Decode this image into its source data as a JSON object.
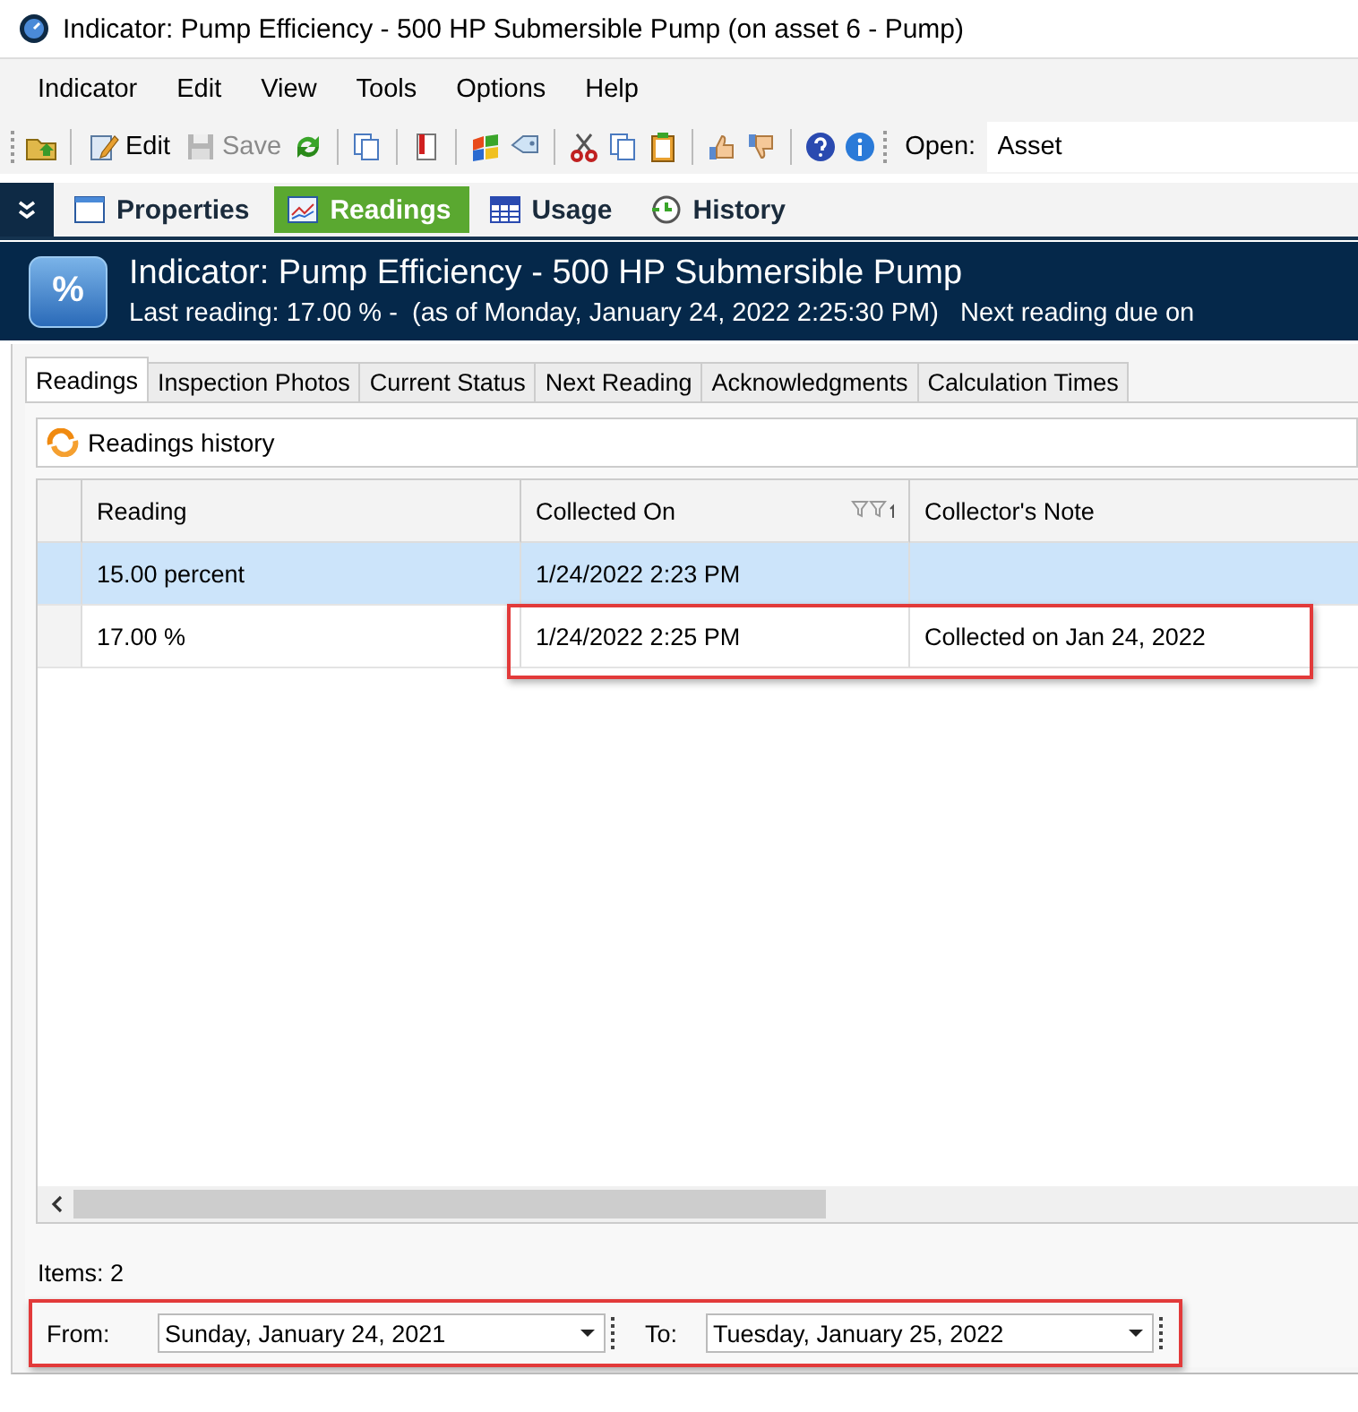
{
  "window": {
    "title": "Indicator: Pump Efficiency - 500 HP Submersible Pump (on asset 6 - Pump)"
  },
  "menu": [
    "Indicator",
    "Edit",
    "View",
    "Tools",
    "Options",
    "Help"
  ],
  "toolbar": [
    {
      "kind": "icon"
    },
    {
      "kind": "separator"
    },
    {
      "kind": "button",
      "label": "Edit",
      "disabled": false
    },
    {
      "kind": "button",
      "label": "Save",
      "disabled": true
    },
    {
      "kind": "icon"
    },
    {
      "kind": "separator"
    },
    {
      "kind": "icon"
    },
    {
      "kind": "separator"
    },
    {
      "kind": "icon"
    },
    {
      "kind": "separator"
    },
    {
      "kind": "icon"
    },
    {
      "kind": "icon"
    },
    {
      "kind": "separator"
    },
    {
      "kind": "icon"
    },
    {
      "kind": "icon"
    },
    {
      "kind": "icon"
    },
    {
      "kind": "separator"
    },
    {
      "kind": "icon"
    },
    {
      "kind": "icon"
    },
    {
      "kind": "separator"
    },
    {
      "kind": "icon"
    },
    {
      "kind": "icon"
    }
  ],
  "open_field": {
    "label": "Open:",
    "value": "Asset"
  },
  "nav_tabs": [
    {
      "label": "Properties",
      "selected": false
    },
    {
      "label": "Readings",
      "selected": true
    },
    {
      "label": "Usage",
      "selected": false
    },
    {
      "label": "History",
      "selected": false
    }
  ],
  "header": {
    "icon_text": "%",
    "title": "Indicator: Pump Efficiency - 500 HP Submersible Pump",
    "subtitle": "Last reading: 17.00 % -  (as of Monday, January 24, 2022 2:25:30 PM)   Next reading due on"
  },
  "tabs": [
    {
      "label": "Readings",
      "selected": true
    },
    {
      "label": "Inspection Photos",
      "selected": false
    },
    {
      "label": "Current Status",
      "selected": false
    },
    {
      "label": "Next Reading",
      "selected": false
    },
    {
      "label": "Acknowledgments",
      "selected": false
    },
    {
      "label": "Calculation Times",
      "selected": false
    }
  ],
  "group_title": "Readings history",
  "grid": {
    "columns": [
      "Reading",
      "Collected On",
      "Collector's Note"
    ],
    "rows": [
      {
        "cells": [
          "15.00 percent",
          "1/24/2022 2:23 PM",
          ""
        ],
        "selected": true,
        "highlighted": false
      },
      {
        "cells": [
          "17.00 %",
          "1/24/2022 2:25 PM",
          "Collected on Jan 24, 2022"
        ],
        "selected": false,
        "highlighted": true
      }
    ]
  },
  "items_count": "Items: 2",
  "date_filter": {
    "highlighted": true,
    "from_label": "From:",
    "from_value": "Sunday, January 24, 2021",
    "to_label": "To:",
    "to_value": "Tuesday, January 25, 2022"
  }
}
